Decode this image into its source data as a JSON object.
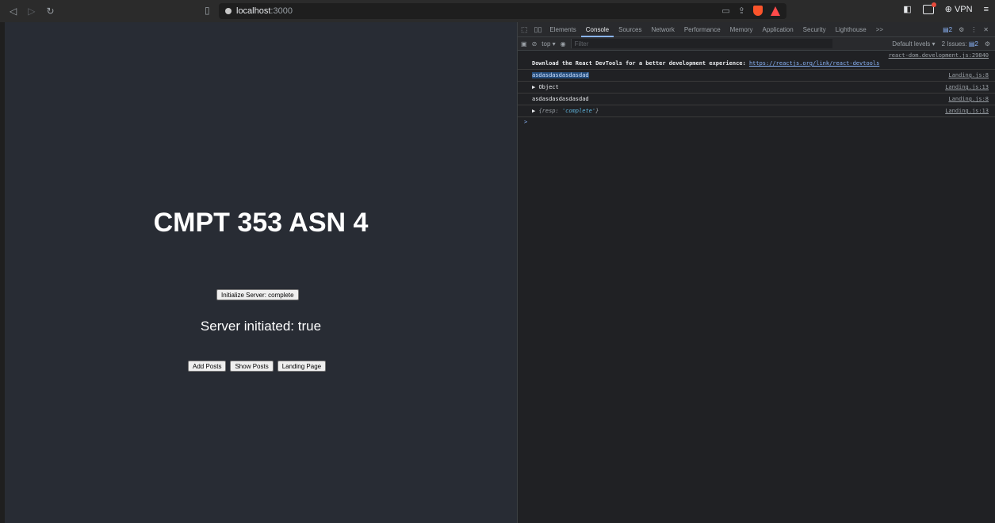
{
  "browser": {
    "url_host": "localhost",
    "url_port": ":3000",
    "vpn_label": "VPN"
  },
  "page": {
    "title": "CMPT 353 ASN 4",
    "init_button": "Initialize Server: complete",
    "status": "Server initiated: true",
    "buttons": [
      "Add Posts",
      "Show Posts",
      "Landing Page"
    ]
  },
  "devtools": {
    "tabs": [
      "Elements",
      "Console",
      "Sources",
      "Network",
      "Performance",
      "Memory",
      "Application",
      "Security",
      "Lighthouse"
    ],
    "more_tabs": ">>",
    "issues_count": "2",
    "toolbar": {
      "context": "top",
      "filter_placeholder": "Filter",
      "levels": "Default levels",
      "issues_label": "2 Issues:",
      "issues_count": "2"
    },
    "logs": [
      {
        "text": "Download the React DevTools for a better development experience: ",
        "link": "https://reactjs.org/link/react-devtools",
        "source": "react-dom.development.js:29840"
      },
      {
        "text": "asdasdasdasdasdad",
        "source": "Landing.js:8"
      },
      {
        "text": "Object",
        "source": "Landing.js:13"
      },
      {
        "text": "asdasdasdasdasdad",
        "source": "Landing.js:8"
      },
      {
        "key": "resp",
        "value": "'complete'",
        "source": "Landing.js:13"
      }
    ],
    "prompt": ">"
  }
}
